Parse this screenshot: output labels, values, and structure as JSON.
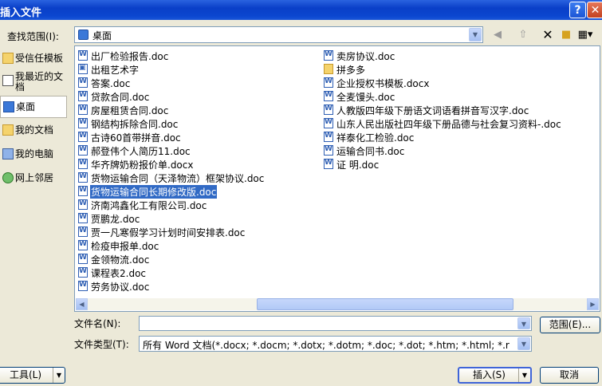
{
  "window": {
    "title": "插入文件",
    "help_icon": "?",
    "close_icon": "✕"
  },
  "toolbar": {
    "look_in_label": "查找范围(I):",
    "look_in_value": "桌面",
    "icons": [
      "back-icon",
      "up-folder-icon",
      "delete-icon",
      "new-folder-icon",
      "views-icon"
    ]
  },
  "places": [
    {
      "label": "受信任模板",
      "icon": "folder-icon"
    },
    {
      "label": "我最近的文档",
      "icon": "recent-docs-icon"
    },
    {
      "label": "桌面",
      "icon": "desktop-icon"
    },
    {
      "label": "我的文档",
      "icon": "my-documents-icon"
    },
    {
      "label": "我的电脑",
      "icon": "my-computer-icon"
    },
    {
      "label": "网上邻居",
      "icon": "network-icon"
    }
  ],
  "files_left": [
    "出厂检验报告.doc",
    "出租艺术字",
    "答案.doc",
    "贷款合同.doc",
    "房屋租赁合同.doc",
    "钢结构拆除合同.doc",
    "古诗60首带拼音.doc",
    "郝登伟个人简历11.doc",
    "华齐牌奶粉报价单.docx",
    "货物运输合同（天泽物流）框架协议.doc",
    "货物运输合同长期修改版.doc",
    "济南鸿鑫化工有限公司.doc",
    "贾鹏龙.doc",
    "贾一凡寒假学习计划时间安排表.doc",
    "检疫申报单.doc",
    "金领物流.doc",
    "课程表2.doc",
    "劳务协议.doc"
  ],
  "files_right": [
    "卖房协议.doc",
    "拼多多",
    "企业授权书模板.docx",
    "全麦馒头.doc",
    "人教版四年级下册语文词语看拼音写汉字.doc",
    "山东人民出版社四年级下册品德与社会复习资料-.doc",
    "祥泰化工检验.doc",
    "运输合同书.doc",
    "证 明.doc"
  ],
  "form": {
    "filename_label": "文件名(N):",
    "filename_value": "",
    "range_button": "范围(E)...",
    "filetype_label": "文件类型(T):",
    "filetype_value": "所有 Word 文档(*.docx; *.docm; *.dotx; *.dotm; *.doc; *.dot; *.htm; *.html; *.r"
  },
  "footer": {
    "tools_label": "工具(L)",
    "insert_label": "插入(S)",
    "cancel_label": "取消"
  }
}
